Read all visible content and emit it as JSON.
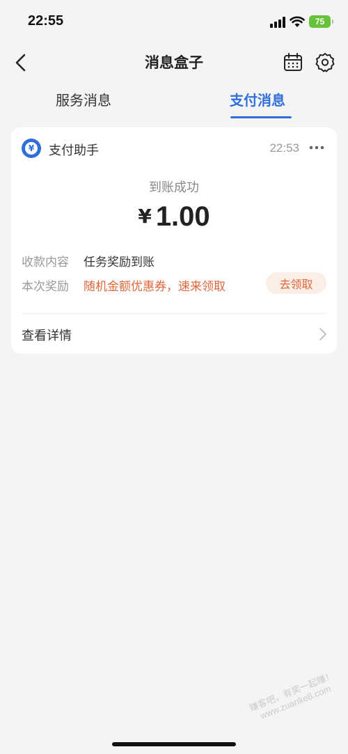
{
  "status_bar": {
    "time": "22:55",
    "battery": "75"
  },
  "nav": {
    "title": "消息盒子"
  },
  "tabs": [
    {
      "label": "服务消息",
      "active": false
    },
    {
      "label": "支付消息",
      "active": true
    }
  ],
  "message": {
    "sender": "支付助手",
    "time": "22:53",
    "status": "到账成功",
    "currency": "¥",
    "amount": "1.00",
    "rows": [
      {
        "label": "收款内容",
        "value": "任务奖励到账"
      },
      {
        "label": "本次奖励",
        "value": "随机金额优惠券，速来领取"
      }
    ],
    "claim_button": "去领取",
    "details": "查看详情"
  },
  "watermark": {
    "line1": "赚客吧，有奖一起赚！",
    "line2": "www.zuanke8.com"
  },
  "colors": {
    "accent": "#2f6fdb",
    "reward": "#e0663b",
    "background": "#f4f4f5"
  }
}
